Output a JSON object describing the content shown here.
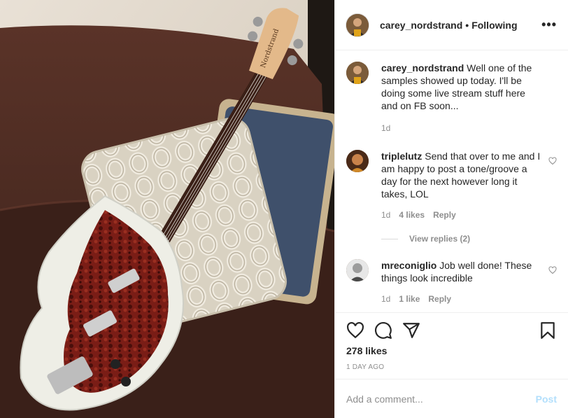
{
  "header": {
    "username": "carey_nordstrand",
    "separator": "•",
    "following": "Following",
    "more": "•••"
  },
  "photo": {
    "headstock_brand": "Nordstrand"
  },
  "caption": {
    "username": "carey_nordstrand",
    "text": "Well one of the samples showed up today. I'll be doing some live stream stuff here and on FB soon...",
    "time": "1d"
  },
  "comments": [
    {
      "username": "triplelutz",
      "text": "Send that over to me and I am happy to post a tone/groove a day for the next however long it takes, LOL",
      "time": "1d",
      "likes": "4 likes",
      "reply": "Reply",
      "view_replies": "View replies (2)"
    },
    {
      "username": "mreconiglio",
      "text": "Job well done! These things look incredible",
      "time": "1d",
      "likes": "1 like",
      "reply": "Reply"
    }
  ],
  "actions": {
    "likes": "278 likes",
    "ago": "1 DAY AGO"
  },
  "add_comment": {
    "placeholder": "Add a comment...",
    "post_label": "Post"
  },
  "colors": {
    "link_disabled": "#b2dffc",
    "muted": "#8e8e8e",
    "text": "#262626",
    "divider": "#efefef"
  }
}
